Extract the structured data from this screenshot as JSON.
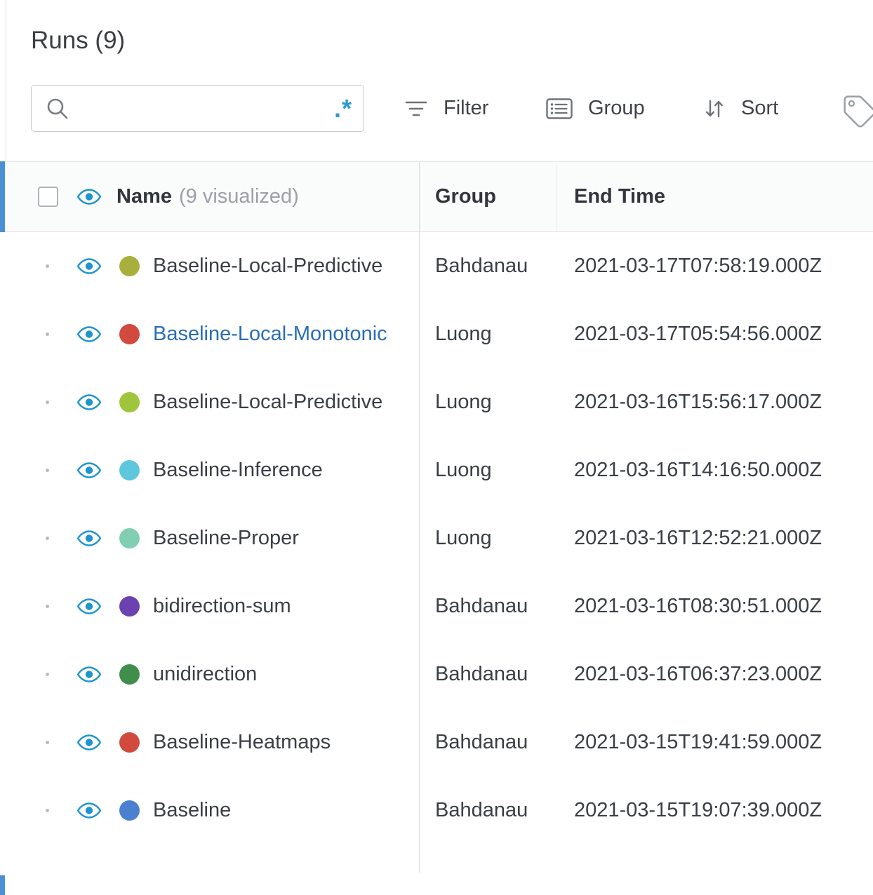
{
  "panel": {
    "title": "Runs (9)"
  },
  "toolbar": {
    "search": {
      "value": "",
      "placeholder": ""
    },
    "regex_label": ".*",
    "filter_label": "Filter",
    "group_label": "Group",
    "sort_label": "Sort"
  },
  "icons": {
    "search": "magnifier",
    "regex": "regex-toggle",
    "filter": "filter-lines",
    "group": "grouped-list",
    "sort": "up-down-arrows",
    "tag": "tag",
    "eye": "visibility-eye"
  },
  "table": {
    "header": {
      "name": "Name",
      "visualized": "(9 visualized)",
      "group": "Group",
      "end_time": "End Time"
    },
    "rows": [
      {
        "name": "Baseline-Local-Predictive",
        "color": "#a9af3d",
        "group": "Bahdanau",
        "end": "2021-03-17T07:58:19.000Z",
        "name_link": false
      },
      {
        "name": "Baseline-Local-Monotonic",
        "color": "#d2493d",
        "group": "Luong",
        "end": "2021-03-17T05:54:56.000Z",
        "name_link": true
      },
      {
        "name": "Baseline-Local-Predictive",
        "color": "#9fc53c",
        "group": "Luong",
        "end": "2021-03-16T15:56:17.000Z",
        "name_link": false
      },
      {
        "name": "Baseline-Inference",
        "color": "#5ec7dd",
        "group": "Luong",
        "end": "2021-03-16T14:16:50.000Z",
        "name_link": false
      },
      {
        "name": "Baseline-Proper",
        "color": "#81ceb2",
        "group": "Luong",
        "end": "2021-03-16T12:52:21.000Z",
        "name_link": false
      },
      {
        "name": "bidirection-sum",
        "color": "#6c42b2",
        "group": "Bahdanau",
        "end": "2021-03-16T08:30:51.000Z",
        "name_link": false
      },
      {
        "name": "unidirection",
        "color": "#3f8e4b",
        "group": "Bahdanau",
        "end": "2021-03-16T06:37:23.000Z",
        "name_link": false
      },
      {
        "name": "Baseline-Heatmaps",
        "color": "#d2493d",
        "group": "Bahdanau",
        "end": "2021-03-15T19:41:59.000Z",
        "name_link": false
      },
      {
        "name": "Baseline",
        "color": "#4b80d1",
        "group": "Bahdanau",
        "end": "2021-03-15T19:07:39.000Z",
        "name_link": false
      }
    ]
  },
  "colors": {
    "accent_bar": "#4a90d2",
    "eye_icon": "#1e95cc",
    "link": "#2a6db5"
  }
}
